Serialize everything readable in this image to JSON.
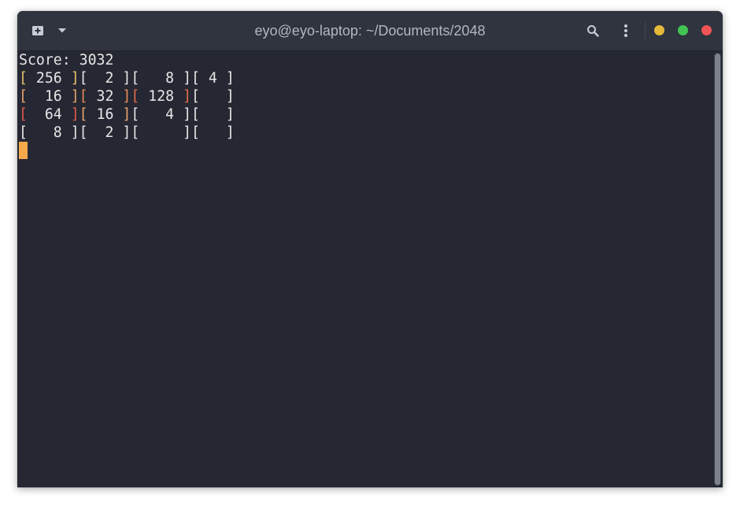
{
  "window": {
    "title": "eyo@eyo-laptop: ~/Documents/2048",
    "controls": {
      "new_tab_icon": "new-tab-icon",
      "tab_menu_icon": "chevron-down-icon",
      "search_icon": "search-icon",
      "menu_icon": "kebab-menu-icon",
      "minimize_color": "#e5b93a",
      "maximize_color": "#42c453",
      "close_color": "#f05454"
    }
  },
  "terminal": {
    "background": "#252833",
    "foreground": "#e6e6e6",
    "cursor_color": "#f5a94b",
    "score_line": "Score: 3032",
    "grid_rows": [
      [
        {
          "open": "[",
          "value": " 256 ",
          "close": "]",
          "color": "#e8c06a"
        },
        {
          "open": "[",
          "value": "  2 ",
          "close": "]",
          "color": "#e6e6e6"
        },
        {
          "open": "[",
          "value": "   8 ",
          "close": "]",
          "color": "#e6e6e6"
        },
        {
          "open": "[",
          "value": " 4 ",
          "close": "]",
          "color": "#e6e6e6"
        }
      ],
      [
        {
          "open": "[",
          "value": "  16 ",
          "close": "]",
          "color": "#e8a36a"
        },
        {
          "open": "[",
          "value": " 32 ",
          "close": "]",
          "color": "#e8895a"
        },
        {
          "open": "[",
          "value": " 128 ",
          "close": "]",
          "color": "#e56a4a"
        },
        {
          "open": "[",
          "value": "   ",
          "close": "]",
          "color": "#e6e6e6"
        }
      ],
      [
        {
          "open": "[",
          "value": "  64 ",
          "close": "]",
          "color": "#e05a4a"
        },
        {
          "open": "[",
          "value": " 16 ",
          "close": "]",
          "color": "#e8a36a"
        },
        {
          "open": "[",
          "value": "   4 ",
          "close": "]",
          "color": "#e6e6e6"
        },
        {
          "open": "[",
          "value": "   ",
          "close": "]",
          "color": "#e6e6e6"
        }
      ],
      [
        {
          "open": "[",
          "value": "   8 ",
          "close": "]",
          "color": "#e6e6e6"
        },
        {
          "open": "[",
          "value": "  2 ",
          "close": "]",
          "color": "#e6e6e6"
        },
        {
          "open": "[",
          "value": "     ",
          "close": "]",
          "color": "#e6e6e6"
        },
        {
          "open": "[",
          "value": "   ",
          "close": "]",
          "color": "#e6e6e6"
        }
      ]
    ]
  }
}
